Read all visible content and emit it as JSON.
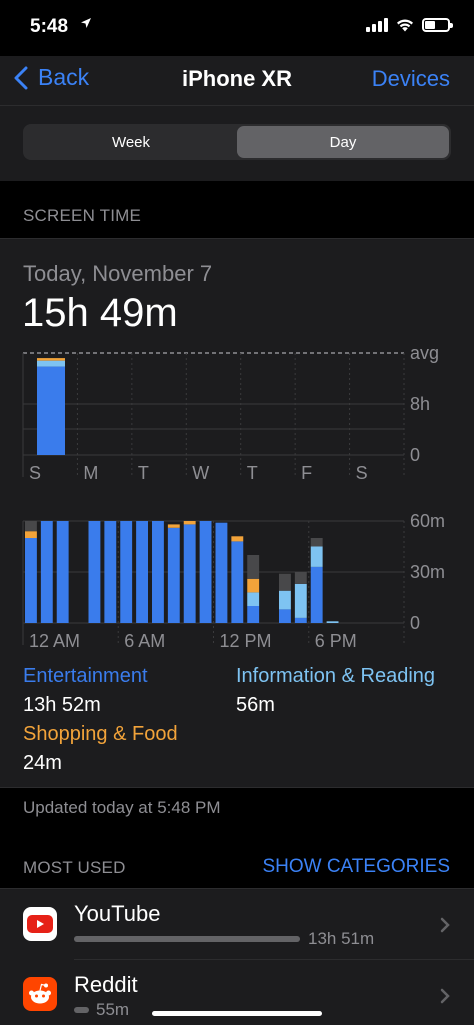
{
  "status": {
    "time": "5:48",
    "location_icon": "location-arrow-icon",
    "battery_fraction": 0.45
  },
  "nav": {
    "back_label": "Back",
    "title": "iPhone XR",
    "right_label": "Devices"
  },
  "segments": [
    {
      "label": "Week",
      "active": false
    },
    {
      "label": "Day",
      "active": true
    }
  ],
  "section_screen_time": "SCREEN TIME",
  "card": {
    "date": "Today, November 7",
    "total": "15h 49m"
  },
  "colors": {
    "entertainment": "#3a7cec",
    "information": "#7ec3f2",
    "shopping": "#f2a33a",
    "other": "#48484a",
    "accent": "#3b82f6"
  },
  "chart_data": [
    {
      "type": "bar",
      "categories": [
        "S",
        "M",
        "T",
        "W",
        "T",
        "F",
        "S"
      ],
      "y_tick_labels": [
        "avg",
        "8h",
        "0"
      ],
      "ylim": [
        0,
        16
      ],
      "series": [
        {
          "name": "Entertainment",
          "values": [
            13.87,
            0,
            0,
            0,
            0,
            0,
            0
          ]
        },
        {
          "name": "Information & Reading",
          "values": [
            0.93,
            0,
            0,
            0,
            0,
            0,
            0
          ]
        },
        {
          "name": "Shopping & Food",
          "values": [
            0.4,
            0,
            0,
            0,
            0,
            0,
            0
          ]
        }
      ]
    },
    {
      "type": "bar",
      "x_tick_labels": [
        "12 AM",
        "6 AM",
        "12 PM",
        "6 PM"
      ],
      "y_tick_labels": [
        "60m",
        "30m",
        "0"
      ],
      "ylim": [
        0,
        60
      ],
      "hours": [
        0,
        1,
        2,
        3,
        4,
        5,
        6,
        7,
        8,
        9,
        10,
        11,
        12,
        13,
        14,
        15,
        16,
        17,
        18,
        19,
        20,
        21,
        22,
        23
      ],
      "series": [
        {
          "name": "Entertainment",
          "values": [
            50,
            60,
            60,
            0,
            60,
            60,
            60,
            60,
            60,
            56,
            58,
            60,
            59,
            48,
            10,
            0,
            8,
            3,
            33,
            0,
            0,
            0,
            0,
            0
          ]
        },
        {
          "name": "Information & Reading",
          "values": [
            0,
            0,
            0,
            0,
            0,
            0,
            0,
            0,
            0,
            0,
            0,
            0,
            0,
            0,
            8,
            0,
            11,
            20,
            12,
            1,
            0,
            0,
            0,
            0
          ]
        },
        {
          "name": "Shopping & Food",
          "values": [
            4,
            0,
            0,
            0,
            0,
            0,
            0,
            0,
            0,
            2,
            2,
            0,
            0,
            3,
            8,
            0,
            0,
            0,
            0,
            0,
            0,
            0,
            0,
            0
          ]
        },
        {
          "name": "Other",
          "values": [
            6,
            0,
            0,
            0,
            0,
            0,
            0,
            0,
            0,
            0,
            0,
            0,
            0,
            0,
            14,
            0,
            10,
            7,
            5,
            0,
            0,
            0,
            0,
            0
          ]
        }
      ]
    }
  ],
  "legend": [
    {
      "label": "Entertainment",
      "value": "13h 52m"
    },
    {
      "label": "Information & Reading",
      "value": "56m"
    },
    {
      "label": "Shopping & Food",
      "value": "24m"
    }
  ],
  "updated": "Updated today at 5:48 PM",
  "most_used": {
    "label": "MOST USED",
    "action": "SHOW CATEGORIES"
  },
  "apps": [
    {
      "name": "YouTube",
      "time": "13h 51m",
      "fraction": 1.0,
      "icon": "youtube-icon"
    },
    {
      "name": "Reddit",
      "time": "55m",
      "fraction": 0.066,
      "icon": "reddit-icon"
    }
  ]
}
